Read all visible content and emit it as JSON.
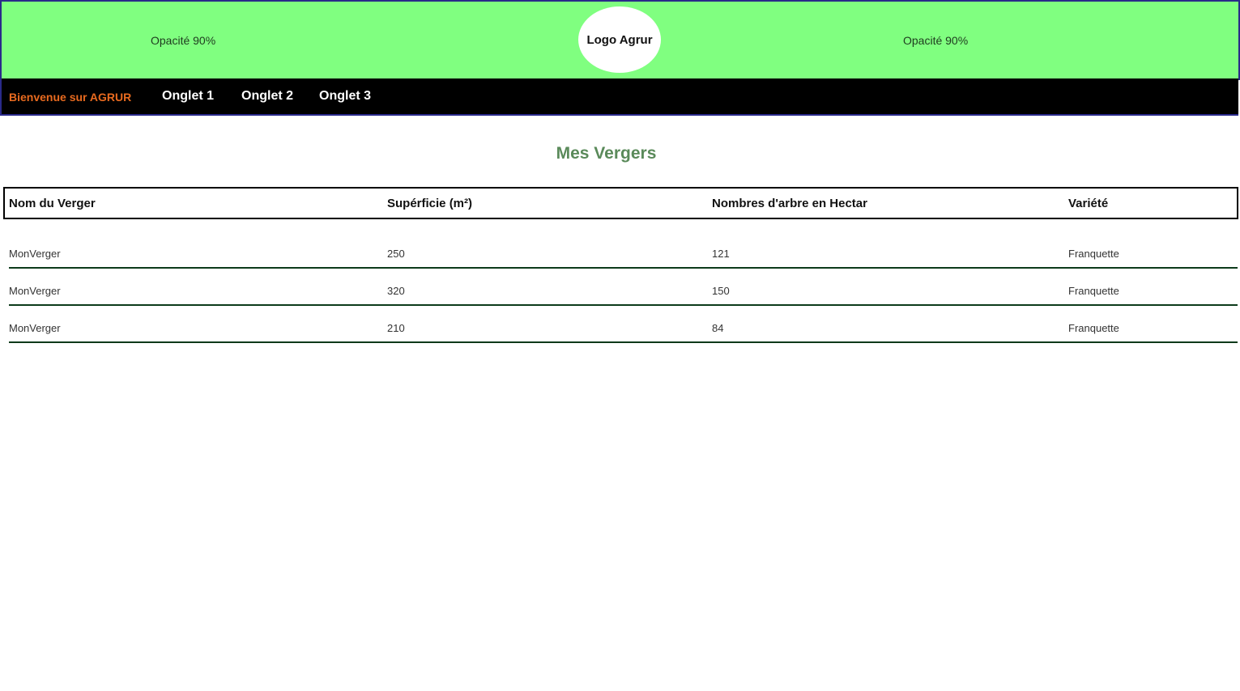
{
  "header": {
    "left_text": "Opacité 90%",
    "right_text": "Opacité 90%",
    "logo_text": "Logo Agrur"
  },
  "nav": {
    "welcome": "Bienvenue sur AGRUR",
    "tabs": [
      {
        "label": "Onglet 1"
      },
      {
        "label": "Onglet 2"
      },
      {
        "label": "Onglet 3"
      }
    ]
  },
  "main": {
    "title": "Mes Vergers",
    "table": {
      "columns": [
        "Nom du Verger",
        "Supérficie (m²)",
        "Nombres d'arbre en Hectar",
        "Variété"
      ],
      "rows": [
        [
          "MonVerger",
          "250",
          "121",
          "Franquette"
        ],
        [
          "MonVerger",
          "320",
          "150",
          "Franquette"
        ],
        [
          "MonVerger",
          "210",
          "84",
          "Franquette"
        ]
      ]
    }
  },
  "colors": {
    "header_bg": "#80ff80",
    "nav_bg": "#000000",
    "welcome_text": "#e86a1f",
    "title_text": "#5a8a5a",
    "row_border": "#0c3a1a"
  }
}
